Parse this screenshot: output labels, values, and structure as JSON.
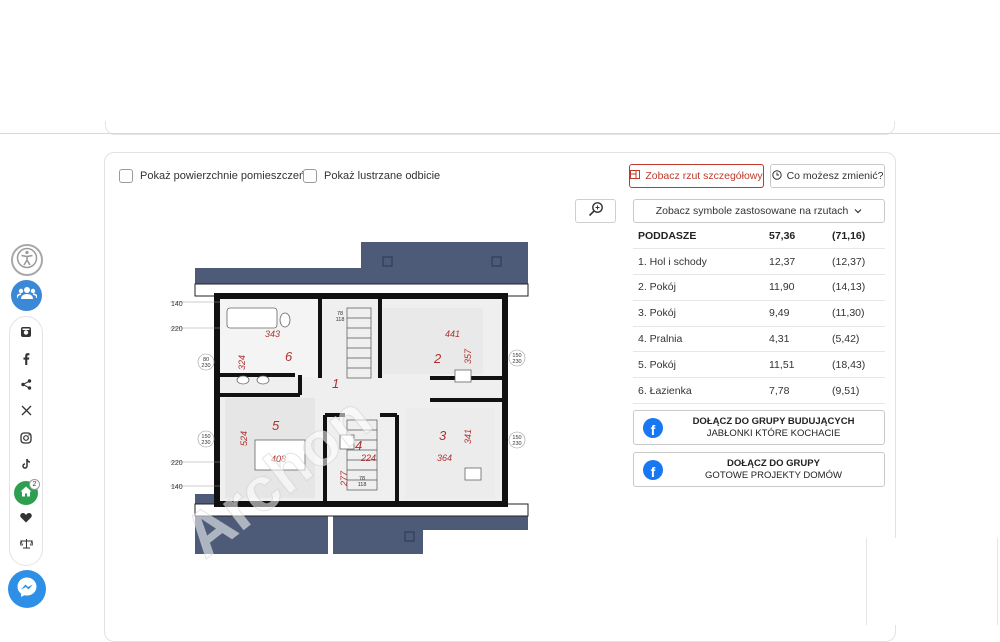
{
  "options": {
    "show_areas_label": "Pokaż powierzchnie pomieszczeń",
    "mirror_label": "Pokaż lustrzane odbicie"
  },
  "actions": {
    "detailed_plan_label": "Zobacz rzut szczegółowy",
    "what_to_change_label": "Co możesz zmienić?",
    "symbols_label": "Zobacz symbole zastosowane na rzutach"
  },
  "rooms_table": {
    "rows": [
      {
        "name": "PODDASZE",
        "area": "57,36",
        "area_total": "(71,16)"
      },
      {
        "name": "1. Hol i schody",
        "area": "12,37",
        "area_total": "(12,37)"
      },
      {
        "name": "2. Pokój",
        "area": "11,90",
        "area_total": "(14,13)"
      },
      {
        "name": "3. Pokój",
        "area": "9,49",
        "area_total": "(11,30)"
      },
      {
        "name": "4. Pralnia",
        "area": "4,31",
        "area_total": "(5,42)"
      },
      {
        "name": "5. Pokój",
        "area": "11,51",
        "area_total": "(18,43)"
      },
      {
        "name": "6. Łazienka",
        "area": "7,78",
        "area_total": "(9,51)"
      }
    ]
  },
  "fb_groups": [
    {
      "title": "DOŁĄCZ DO GRUPY BUDUJĄCYCH",
      "subtitle": "JABŁONKI KTÓRE KOCHACIE"
    },
    {
      "title": "DOŁĄCZ DO GRUPY",
      "subtitle": "GOTOWE PROJEKTY DOMÓW"
    }
  ],
  "plan": {
    "room_numbers": [
      "1",
      "2",
      "3",
      "4",
      "5",
      "6"
    ],
    "dims": {
      "left_140_top": "140",
      "left_220_top": "220",
      "left_220_bottom": "220",
      "left_140_bottom": "140",
      "win_left_top_a": "80",
      "win_left_top_b": "230",
      "win_left_bot_a": "150",
      "win_left_bot_b": "230",
      "win_right_top_a": "150",
      "win_right_top_b": "230",
      "win_right_bot_a": "150",
      "win_right_bot_b": "230",
      "d343": "343",
      "d324": "324",
      "d441": "441",
      "d357": "357",
      "d524": "524",
      "d408": "408",
      "d224": "224",
      "d277": "277",
      "d364": "364",
      "d341": "341",
      "door_top_a": "78",
      "door_top_b": "118",
      "door_bot_a": "78",
      "door_bot_b": "118"
    },
    "watermark": "Archon"
  },
  "sidebar": {
    "home_badge": "2"
  },
  "colors": {
    "accent_red": "#c0392b",
    "roof_blue": "#4d5b78",
    "facebook": "#1877f2"
  }
}
